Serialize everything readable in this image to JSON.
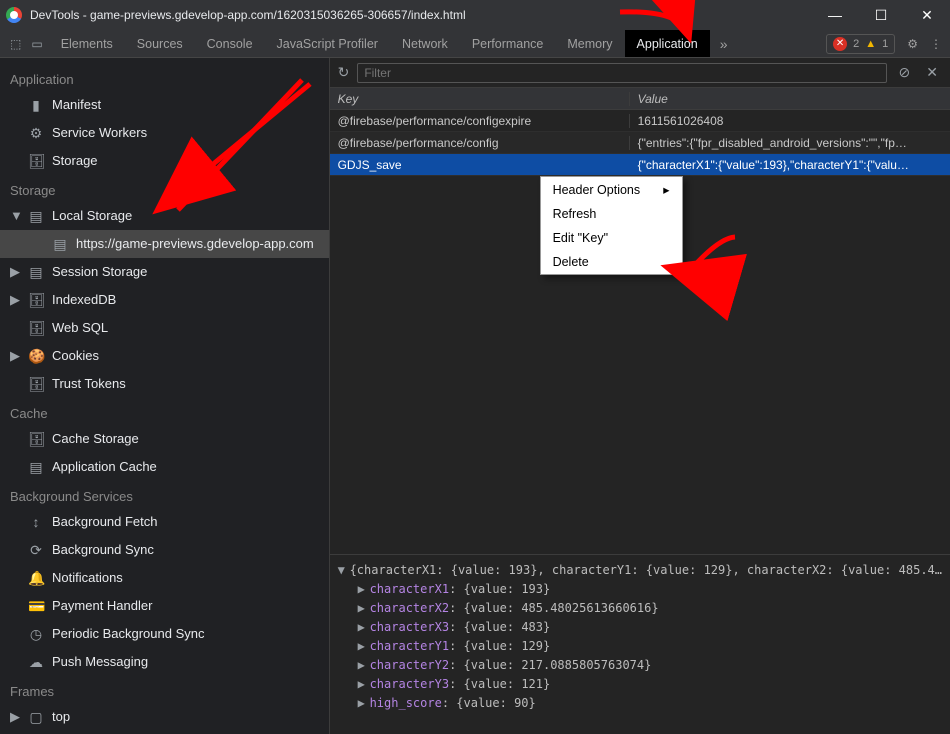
{
  "window": {
    "title": "DevTools - game-previews.gdevelop-app.com/1620315036265-306657/index.html"
  },
  "tabs": {
    "items": [
      "Elements",
      "Sources",
      "Console",
      "JavaScript Profiler",
      "Network",
      "Performance",
      "Memory",
      "Application"
    ],
    "active": "Application",
    "errors": 2,
    "warnings": 1
  },
  "toolbar": {
    "filter_placeholder": "Filter"
  },
  "sidebar": {
    "section_application": "Application",
    "application_items": [
      {
        "label": "Manifest",
        "icon": "📄"
      },
      {
        "label": "Service Workers",
        "icon": "⚙"
      },
      {
        "label": "Storage",
        "icon": "🗄"
      }
    ],
    "section_storage": "Storage",
    "storage_items": [
      {
        "label": "Local Storage",
        "icon": "▤",
        "expanded": true
      },
      {
        "label": "https://game-previews.gdevelop-app.com",
        "icon": "▤",
        "child": true,
        "selected": true
      },
      {
        "label": "Session Storage",
        "icon": "▤",
        "caret": true
      },
      {
        "label": "IndexedDB",
        "icon": "🗄",
        "caret": true
      },
      {
        "label": "Web SQL",
        "icon": "🗄"
      },
      {
        "label": "Cookies",
        "icon": "🍪",
        "caret": true
      },
      {
        "label": "Trust Tokens",
        "icon": "🗄"
      }
    ],
    "section_cache": "Cache",
    "cache_items": [
      {
        "label": "Cache Storage",
        "icon": "🗄"
      },
      {
        "label": "Application Cache",
        "icon": "▤"
      }
    ],
    "section_bg": "Background Services",
    "bg_items": [
      {
        "label": "Background Fetch",
        "icon": "↕"
      },
      {
        "label": "Background Sync",
        "icon": "⟳"
      },
      {
        "label": "Notifications",
        "icon": "🔔"
      },
      {
        "label": "Payment Handler",
        "icon": "💳"
      },
      {
        "label": "Periodic Background Sync",
        "icon": "◷"
      },
      {
        "label": "Push Messaging",
        "icon": "☁"
      }
    ],
    "section_frames": "Frames",
    "frames_items": [
      {
        "label": "top",
        "icon": "▢",
        "caret": true
      }
    ]
  },
  "table": {
    "head_key": "Key",
    "head_value": "Value",
    "rows": [
      {
        "key": "@firebase/performance/configexpire",
        "value": "1611561026408"
      },
      {
        "key": "@firebase/performance/config",
        "value": "{\"entries\":{\"fpr_disabled_android_versions\":\"\",\"fp…"
      },
      {
        "key": "GDJS_save",
        "value": "{\"characterX1\":{\"value\":193},\"characterY1\":{\"valu…",
        "selected": true
      }
    ]
  },
  "context_menu": {
    "items": [
      "Header Options",
      "Refresh",
      "Edit \"Key\"",
      "Delete"
    ]
  },
  "details": {
    "summary": "{characterX1: {value: 193}, characterY1: {value: 129}, characterX2: {value: 485.4…",
    "lines": [
      {
        "k": "characterX1",
        "v": "{value: 193}"
      },
      {
        "k": "characterX2",
        "v": "{value: 485.48025613660616}"
      },
      {
        "k": "characterX3",
        "v": "{value: 483}"
      },
      {
        "k": "characterY1",
        "v": "{value: 129}"
      },
      {
        "k": "characterY2",
        "v": "{value: 217.0885805763074}"
      },
      {
        "k": "characterY3",
        "v": "{value: 121}"
      },
      {
        "k": "high_score",
        "v": "{value: 90}"
      }
    ]
  }
}
